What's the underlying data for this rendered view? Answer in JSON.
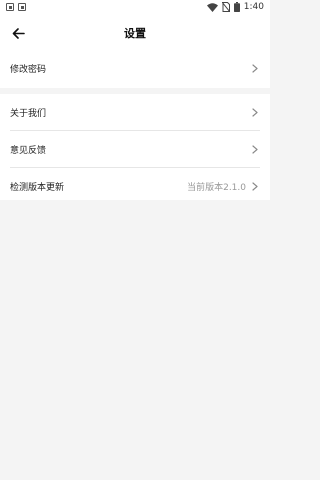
{
  "status_bar": {
    "time": "1:40",
    "icons": [
      "notification-icon",
      "notification-icon",
      "wifi-icon",
      "no-sim-icon",
      "battery-icon"
    ]
  },
  "header": {
    "title": "设置",
    "back_icon": "arrow-left-icon"
  },
  "settings": {
    "change_password": {
      "label": "修改密码"
    },
    "about_us": {
      "label": "关于我们"
    },
    "feedback": {
      "label": "意见反馈"
    },
    "check_update": {
      "label": "检测版本更新",
      "value": "当前版本2.1.0"
    }
  },
  "colors": {
    "background": "#f4f4f4",
    "card": "#ffffff",
    "divider": "#e6e6e6",
    "text": "#222222",
    "secondary_text": "#999999"
  }
}
